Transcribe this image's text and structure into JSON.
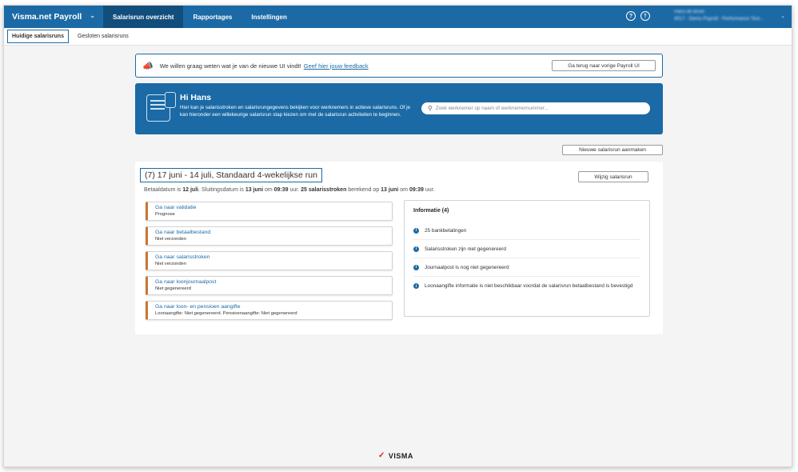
{
  "app": {
    "brand": "Visma.net Payroll",
    "nav": [
      "Salarisrun overzicht",
      "Rapportages",
      "Instellingen"
    ],
    "user_name": "Hans de Bruin",
    "user_company": "4017 - Demo Payroll - Performance Test..."
  },
  "subtabs": [
    "Huidige salarisruns",
    "Gesloten salarisruns"
  ],
  "feedback": {
    "text": "We willen graag weten wat je van de nieuwe UI vindt!",
    "link": "Geef hier jouw feedback",
    "button": "Ga terug naar vorige Payroll UI"
  },
  "hero": {
    "greeting": "Hi Hans",
    "text": "Hier kan je salarisstroken en salarisrungegevens bekijken voor werknemers in actieve salarisruns. Of je kan hieronder een willekeurige salarisrun stap kiezen om met de salarisrun activiteiten te beginnen.",
    "search_placeholder": "Zoek werknemer op naam of werknemernummer..."
  },
  "new_run_button": "Nieuwe salarisrun aanmaken",
  "run": {
    "title": "(7) 17 juni - 14 juli, Standaard 4-wekelijkse run",
    "change_button": "Wijzig salarisrun",
    "meta": {
      "p1": "Betaaldatum is ",
      "pay_date": "12 juli",
      "p2": ". Sluitingsdatum is ",
      "close_date": "13 juni",
      "p3": " om ",
      "close_time": "09:39",
      "p4": " uur. ",
      "slips": "25 salarisstroken",
      "p5": " berekend op ",
      "calc_date": "13 juni",
      "p6": " om ",
      "calc_time": "09:39",
      "p7": " uur."
    },
    "steps": [
      {
        "link": "Ga naar validatie",
        "status": "Prognose"
      },
      {
        "link": "Ga naar betaalbestand",
        "status": "Niet verzonden"
      },
      {
        "link": "Ga naar salarisstroken",
        "status": "Niet verzonden"
      },
      {
        "link": "Ga naar loonjournaalpost",
        "status": "Niet gegenereerd"
      },
      {
        "link": "Ga naar loon- en pensioen aangifte",
        "status": "Loonaangifte: Niet gegenereerd. Pensioenaangifte: Niet gegenereerd"
      }
    ]
  },
  "info": {
    "title": "Informatie (4)",
    "items": [
      "25 bankbetalingen",
      "Salarisstroken zijn niet gegenereerd",
      "Journaalpost is nog niet gegenereerd",
      "Loonaangifte informatie is niet beschikbaar voordat de salarisrun betaalbestand is bevestigd"
    ]
  },
  "footer": {
    "logo": "VISMA"
  }
}
